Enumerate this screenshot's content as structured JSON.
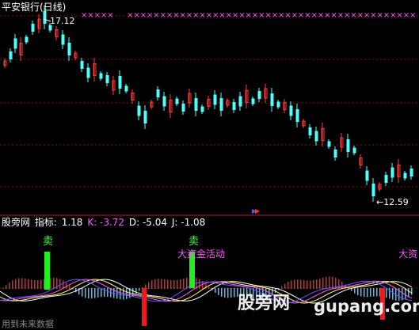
{
  "window": {
    "title": "平安银行(日线)"
  },
  "price_panel": {
    "high_marker": "17.12",
    "low_marker": "12.59",
    "colors": {
      "up": "#ff3c3c",
      "down": "#50ffff",
      "marker": "#ff55ff",
      "grid": "#8a1010"
    }
  },
  "indicator_panel": {
    "name": "股旁网",
    "label": "指标:",
    "value": "1.18",
    "k": "K: -3.72",
    "d": "D: -5.04",
    "j": "J: -1.08",
    "sell_1": "卖",
    "sell_2": "卖",
    "big_fund_1": "大资金活动",
    "big_fund_2": "大资",
    "footer_note": "用到未来数据"
  },
  "watermark": {
    "text": "股旁网",
    "domain": "gupang.com"
  }
}
